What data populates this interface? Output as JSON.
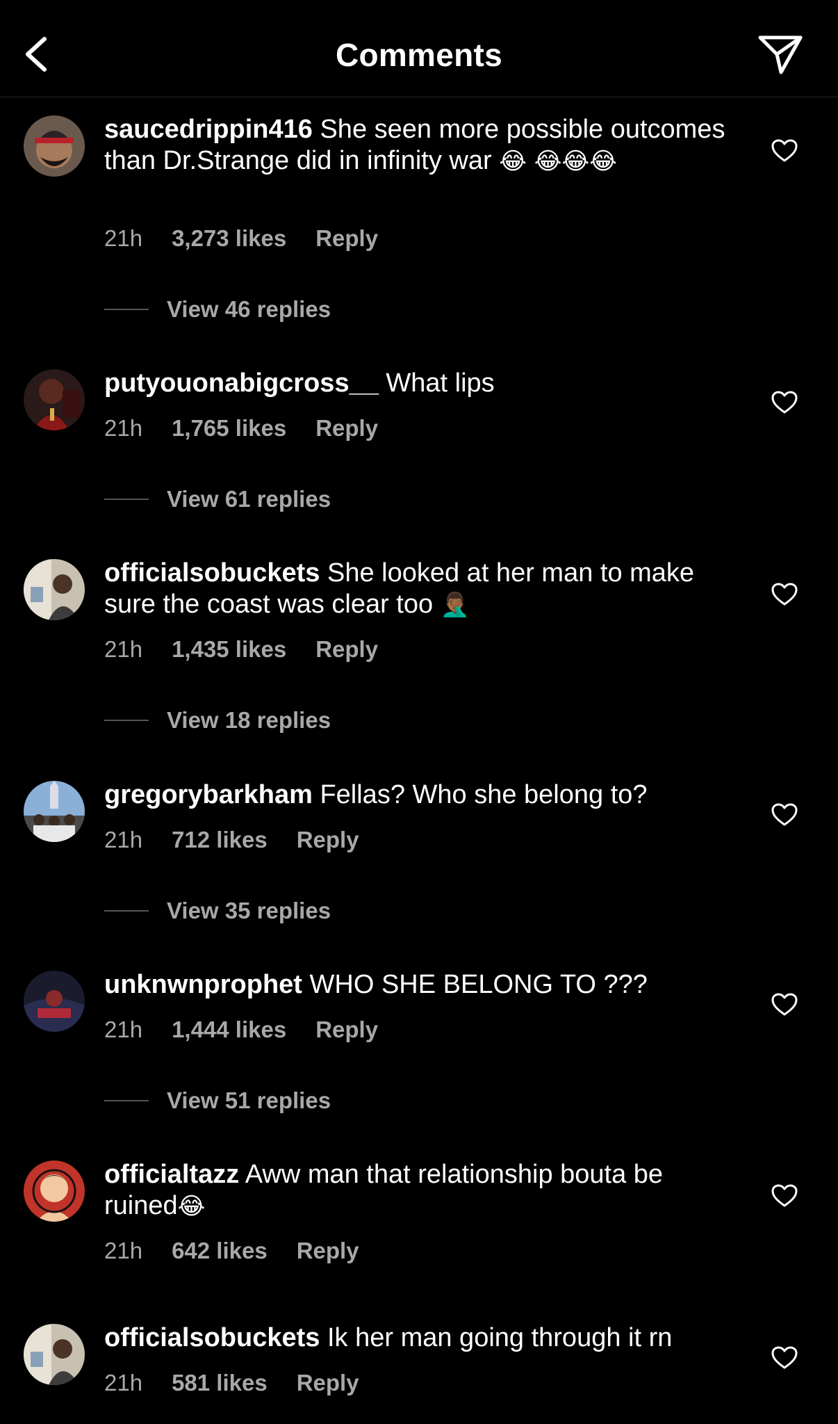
{
  "header": {
    "title": "Comments",
    "back_icon": "chevron-left-icon",
    "share_icon": "paper-plane-icon"
  },
  "comments": [
    {
      "username": "saucedrippin416",
      "text": " She seen more possible outcomes than Dr.Strange did in infinity war ",
      "emoji": "😂 😂😂😂",
      "time": "21h",
      "likes": "3,273 likes",
      "reply": "Reply",
      "view_replies": "View 46 replies"
    },
    {
      "username": "putyouonabigcross__",
      "text": " What lips",
      "emoji": "",
      "time": "21h",
      "likes": "1,765 likes",
      "reply": "Reply",
      "view_replies": "View 61 replies"
    },
    {
      "username": "officialsobuckets",
      "text": " She looked at her man to make sure the coast was clear too ",
      "emoji": "🤦🏾‍♂️",
      "time": "21h",
      "likes": "1,435 likes",
      "reply": "Reply",
      "view_replies": "View 18 replies"
    },
    {
      "username": "gregorybarkham",
      "text": " Fellas? Who she belong to?",
      "emoji": "",
      "time": "21h",
      "likes": "712 likes",
      "reply": "Reply",
      "view_replies": "View 35 replies"
    },
    {
      "username": "unknwnprophet",
      "text": " WHO SHE BELONG TO ???",
      "emoji": "",
      "time": "21h",
      "likes": "1,444 likes",
      "reply": "Reply",
      "view_replies": "View 51 replies"
    },
    {
      "username": "officialtazz",
      "text": " Aww man that relationship bouta be ruined",
      "emoji": "😂",
      "time": "21h",
      "likes": "642 likes",
      "reply": "Reply",
      "view_replies": ""
    },
    {
      "username": "officialsobuckets",
      "text": " Ik her man going through it rn",
      "emoji": "",
      "time": "21h",
      "likes": "581 likes",
      "reply": "Reply",
      "view_replies": ""
    }
  ],
  "icons": {
    "like": "heart-outline-icon"
  },
  "colors": {
    "background": "#000000",
    "text": "#ffffff",
    "secondary": "#a8a8a8"
  }
}
